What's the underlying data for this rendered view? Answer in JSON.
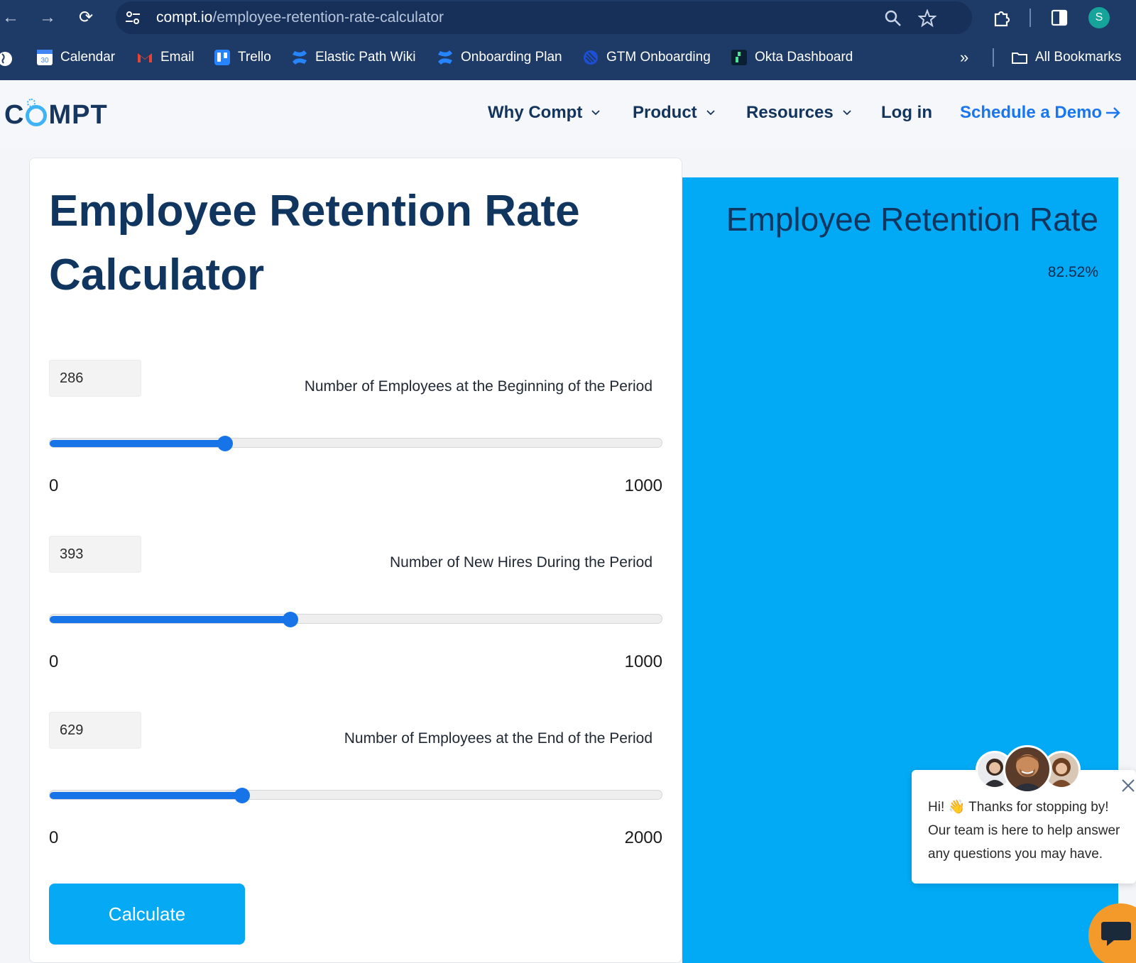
{
  "browser": {
    "url_host": "compt.io",
    "url_path": "/employee-retention-rate-calculator",
    "profile_initial": "S",
    "bookmarks": [
      {
        "label": "Calendar",
        "icon": "google-calendar-icon"
      },
      {
        "label": "Email",
        "icon": "gmail-icon"
      },
      {
        "label": "Trello",
        "icon": "trello-icon"
      },
      {
        "label": "Elastic Path Wiki",
        "icon": "confluence-icon"
      },
      {
        "label": "Onboarding Plan",
        "icon": "confluence-icon"
      },
      {
        "label": "GTM Onboarding",
        "icon": "linear-icon"
      },
      {
        "label": "Okta Dashboard",
        "icon": "okta-icon"
      }
    ],
    "all_bookmarks_label": "All Bookmarks"
  },
  "site": {
    "logo_prefix": "C",
    "logo_suffix": "MPT",
    "nav": [
      {
        "label": "Why Compt",
        "has_dropdown": true
      },
      {
        "label": "Product",
        "has_dropdown": true
      },
      {
        "label": "Resources",
        "has_dropdown": true
      },
      {
        "label": "Log in",
        "has_dropdown": false
      }
    ],
    "cta_label": "Schedule a Demo",
    "accent_color": "#1976f0"
  },
  "calculator": {
    "title": "Employee Retention Rate Calculator",
    "fields": [
      {
        "value": "286",
        "label": "Number of Employees at the Beginning of the Period",
        "min": "0",
        "max": "1000",
        "slider_value": 286,
        "slider_max": 1000
      },
      {
        "value": "393",
        "label": "Number of New Hires During the Period",
        "min": "0",
        "max": "1000",
        "slider_value": 393,
        "slider_max": 1000
      },
      {
        "value": "629",
        "label": "Number of Employees at the End of the Period",
        "min": "0",
        "max": "2000",
        "slider_value": 629,
        "slider_max": 2000
      }
    ],
    "button_label": "Calculate",
    "button_color": "#06a9f4"
  },
  "result": {
    "title": "Employee Retention Rate",
    "value": "82.52%",
    "panel_color": "#02aaf5"
  },
  "chat": {
    "line1": "Hi! 👋 Thanks for stopping by!",
    "line2": "Our team is here to help answer",
    "line3": "any questions you may have."
  }
}
